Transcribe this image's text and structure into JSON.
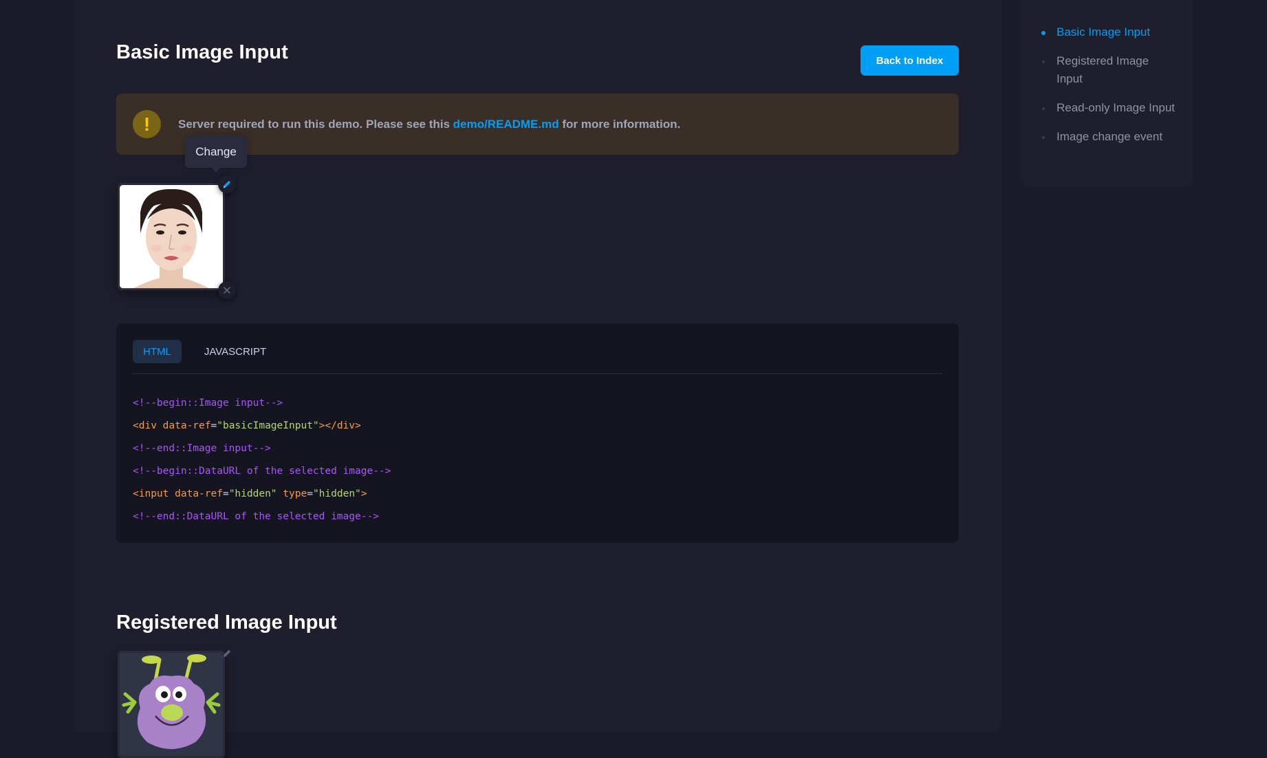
{
  "page": {
    "title": "Basic Image Input",
    "back_button_label": "Back to Index"
  },
  "notice": {
    "icon": "exclamation-icon",
    "text_before": "Server required to run this demo. Please see this ",
    "link_text": "demo/README.md",
    "text_after": " for more information.",
    "accent_color": "#ffc700"
  },
  "image_input": {
    "tooltip": "Change",
    "change_icon": "pencil-icon",
    "remove_icon": "close-icon"
  },
  "code": {
    "tabs": [
      {
        "label": "HTML",
        "active": true
      },
      {
        "label": "JAVASCRIPT",
        "active": false
      }
    ]
  },
  "section2": {
    "title": "Registered Image Input"
  },
  "sidebar": {
    "items": [
      {
        "label": "Basic Image Input",
        "active": true
      },
      {
        "label": "Registered Image Input",
        "active": false
      },
      {
        "label": "Read-only Image Input",
        "active": false
      },
      {
        "label": "Image change event",
        "active": false
      }
    ]
  },
  "colors": {
    "primary": "#009ef7",
    "background": "#1b1b29",
    "card": "#1e1e2d",
    "code_bg": "#151521"
  }
}
